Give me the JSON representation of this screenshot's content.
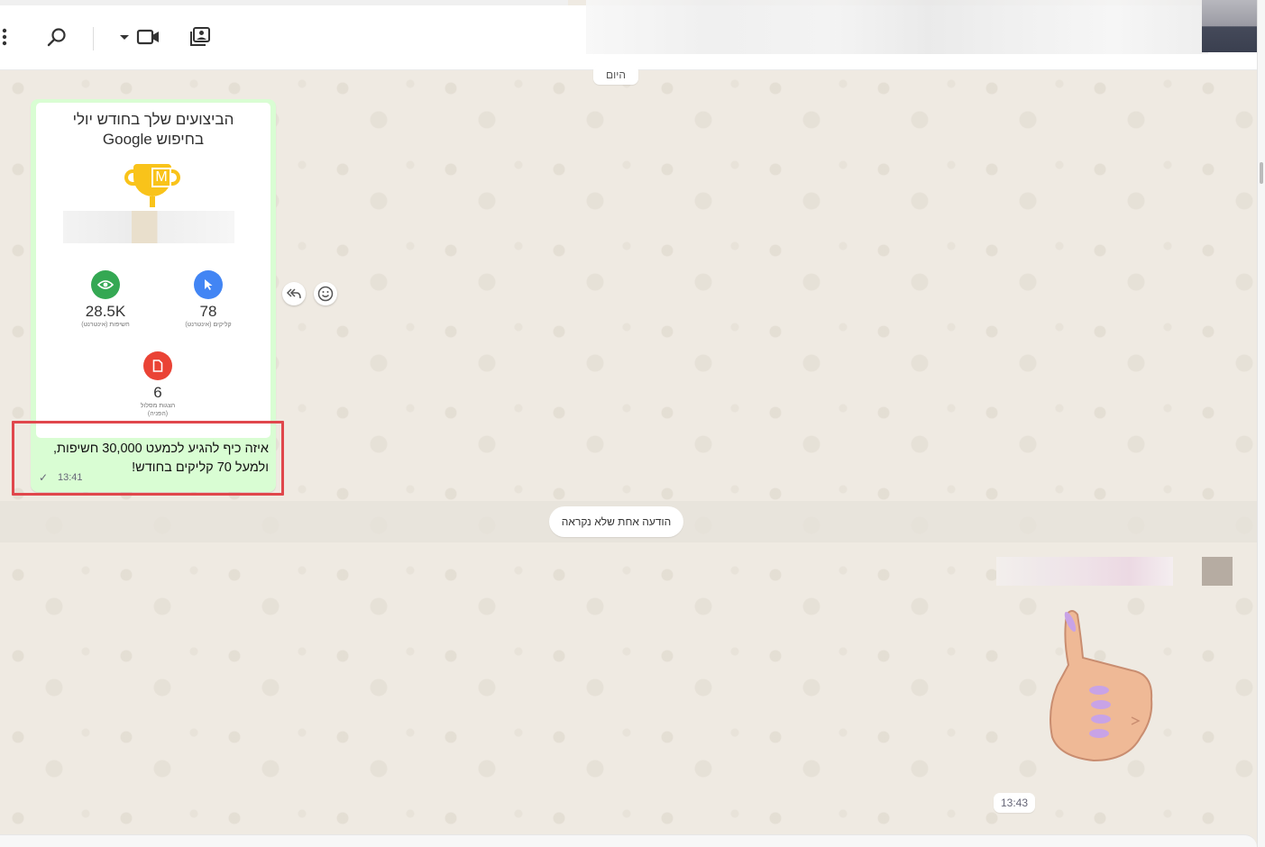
{
  "header": {
    "icons": [
      "menu-dots-icon",
      "search-icon",
      "video-call-icon",
      "gallery-icon"
    ]
  },
  "chat": {
    "date_chip": "היום",
    "image_message": {
      "card": {
        "title_line1": "הביצועים שלך בחודש יולי",
        "title_line2": "בחיפוש Google",
        "trophy_letter": "M",
        "stats": [
          {
            "value": "28.5K",
            "label": "חשיפות (אינטרנט)",
            "icon": "eye-icon",
            "color": "#34a853"
          },
          {
            "value": "78",
            "label": "קליקים (אינטרנט)",
            "icon": "cursor-icon",
            "color": "#4285f4"
          },
          {
            "value": "6",
            "label": "הצגות מסלול",
            "label_line2": "(הפניה)",
            "icon": "document-icon",
            "color": "#ea4335"
          }
        ]
      },
      "text": "איזה כיף להגיע לכמעט 30,000 חשיפות, ולמעל 70 קליקים בחודש!",
      "time": "13:41",
      "status": "✓"
    },
    "unread_notice": "הודעה אחת שלא נקראה",
    "sticker_message": {
      "sticker": "thumbs-up-sticker",
      "time": "13:43"
    }
  },
  "colors": {
    "chat_background": "#efeae2",
    "outgoing_bubble": "#d9fdd3",
    "highlight_border": "#e0474c"
  }
}
